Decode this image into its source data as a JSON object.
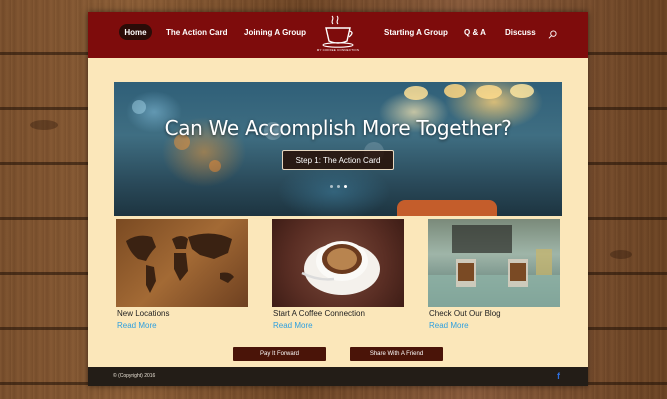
{
  "nav": {
    "items": [
      {
        "label": "Home",
        "active": true
      },
      {
        "label": "The Action Card"
      },
      {
        "label": "Joining A Group"
      },
      {
        "label": "Starting A Group"
      },
      {
        "label": "Q & A"
      },
      {
        "label": "Discuss"
      }
    ],
    "logo_text": "MY COFFEE CONNECTION",
    "search_icon": "search-icon"
  },
  "hero": {
    "title": "Can We Accomplish More Together?",
    "button_label": "Step 1: The Action Card",
    "slide_count": 3,
    "active_slide": 3
  },
  "cards": [
    {
      "title": "New Locations",
      "link": "Read More",
      "image": "world-map-on-wood"
    },
    {
      "title": "Start A Coffee Connection",
      "link": "Read More",
      "image": "coffee-cup-on-saucer"
    },
    {
      "title": "Check Out Our Blog",
      "link": "Read More",
      "image": "cafe-table-with-coffees"
    }
  ],
  "actions": {
    "pay_it_forward": "Pay It Forward",
    "share": "Share With A Friend"
  },
  "footer": {
    "copyright": "© (Copyright) 2016",
    "social_icon": "facebook-icon"
  },
  "colors": {
    "header": "#7e0c0c",
    "page_bg": "#fbe7ba",
    "footer": "#231d17",
    "link": "#2e9fdf",
    "button": "#4a1408"
  }
}
